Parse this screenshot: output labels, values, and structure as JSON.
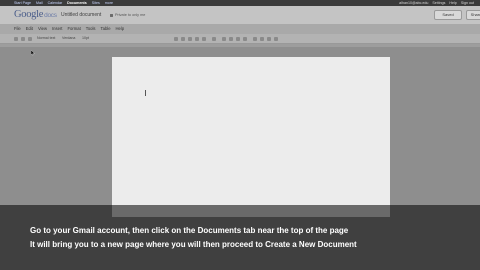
{
  "googlebar": {
    "links": [
      "Start Page",
      "Mail",
      "Calendar",
      "Documents",
      "Sites",
      "more"
    ],
    "active_index": 3,
    "account": "alhan10@abc.edu",
    "settings": "Settings",
    "help": "Help",
    "sign_out": "Sign out"
  },
  "docbar": {
    "logo_main": "Google",
    "logo_sub": "docs",
    "title": "Untitled document",
    "privacy": "Private to only me",
    "saved_label": "Saved",
    "share_label": "Share"
  },
  "menubar": {
    "items": [
      "File",
      "Edit",
      "View",
      "Insert",
      "Format",
      "Tools",
      "Table",
      "Help"
    ]
  },
  "toolbar": {
    "style_label": "Normal text",
    "font_label": "Verdana",
    "size_label": "10pt"
  },
  "caption": {
    "line1": "Go to your Gmail account, then click on the Documents tab near the top of the page",
    "line2": "It will bring you to a new page where you will then proceed to Create a New Document"
  }
}
